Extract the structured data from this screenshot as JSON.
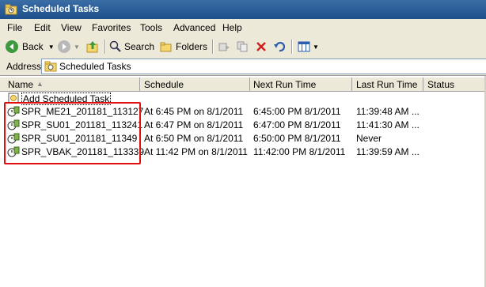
{
  "window": {
    "title": "Scheduled Tasks"
  },
  "menu": [
    {
      "label": "File"
    },
    {
      "label": "Edit"
    },
    {
      "label": "View"
    },
    {
      "label": "Favorites"
    },
    {
      "label": "Tools"
    },
    {
      "label": "Advanced"
    },
    {
      "label": "Help"
    }
  ],
  "toolbar": {
    "back_label": "Back",
    "search_label": "Search",
    "folders_label": "Folders"
  },
  "address": {
    "label": "Address",
    "value": "Scheduled Tasks"
  },
  "list": {
    "columns": [
      "Name",
      "Schedule",
      "Next Run Time",
      "Last Run Time",
      "Status"
    ],
    "add_item": "Add Scheduled Task",
    "rows": [
      {
        "name": "SPR_ME21_201181_113127",
        "schedule": "At 6:45 PM on 8/1/2011",
        "next": "6:45:00 PM  8/1/2011",
        "last": "11:39:48 AM ...",
        "status": ""
      },
      {
        "name": "SPR_SU01_201181_113241",
        "schedule": "At 6:47 PM on 8/1/2011",
        "next": "6:47:00 PM  8/1/2011",
        "last": "11:41:30 AM ...",
        "status": ""
      },
      {
        "name": "SPR_SU01_201181_11349",
        "schedule": "At 6:50 PM on 8/1/2011",
        "next": "6:50:00 PM  8/1/2011",
        "last": "Never",
        "status": ""
      },
      {
        "name": "SPR_VBAK_201181_113339",
        "schedule": "At 11:42 PM on 8/1/2011",
        "next": "11:42:00 PM  8/1/2011",
        "last": "11:39:59 AM ...",
        "status": ""
      }
    ]
  },
  "colors": {
    "title_bar": "#1e4f8a",
    "highlight": "#e01010",
    "chrome": "#ece9d8"
  }
}
